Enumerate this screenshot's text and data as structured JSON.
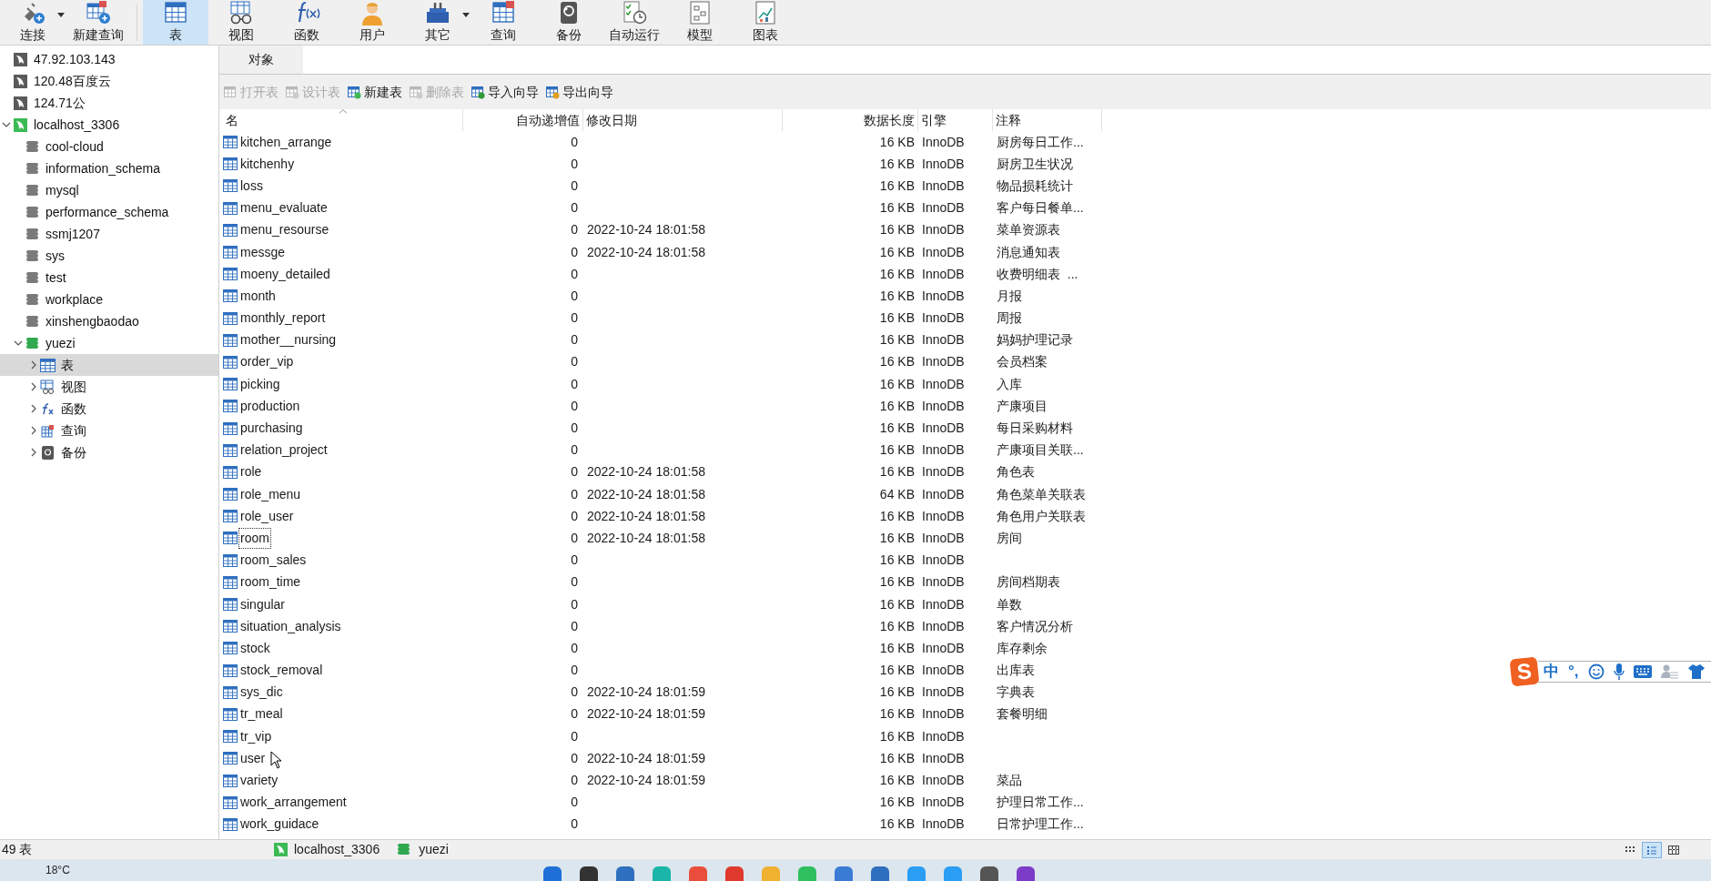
{
  "toolbar": [
    {
      "label": "连接",
      "kind": "connect",
      "selected": false,
      "has_menu": true
    },
    {
      "label": "新建查询",
      "kind": "new_query",
      "selected": false,
      "has_menu": false
    },
    {
      "label": "表",
      "kind": "table",
      "selected": true,
      "has_menu": false
    },
    {
      "label": "视图",
      "kind": "view",
      "selected": false,
      "has_menu": false
    },
    {
      "label": "函数",
      "kind": "function",
      "selected": false,
      "has_menu": false
    },
    {
      "label": "用户",
      "kind": "user",
      "selected": false,
      "has_menu": false
    },
    {
      "label": "其它",
      "kind": "other",
      "selected": false,
      "has_menu": true
    },
    {
      "label": "查询",
      "kind": "query",
      "selected": false,
      "has_menu": false
    },
    {
      "label": "备份",
      "kind": "backup",
      "selected": false,
      "has_menu": false
    },
    {
      "label": "自动运行",
      "kind": "schedule",
      "selected": false,
      "has_menu": false
    },
    {
      "label": "模型",
      "kind": "model",
      "selected": false,
      "has_menu": false
    },
    {
      "label": "图表",
      "kind": "chart",
      "selected": false,
      "has_menu": false
    }
  ],
  "tree": [
    {
      "label": "47.92.103.143",
      "kind": "connection",
      "open": false,
      "selected": false
    },
    {
      "label": "120.48百度云",
      "kind": "connection",
      "open": false,
      "selected": false
    },
    {
      "label": "124.71公",
      "kind": "connection",
      "open": false,
      "selected": false
    },
    {
      "label": "localhost_3306",
      "kind": "connection",
      "open": true,
      "selected": false,
      "expanded": true,
      "children": [
        {
          "label": "cool-cloud",
          "kind": "database",
          "open": false,
          "selected": false
        },
        {
          "label": "information_schema",
          "kind": "database",
          "open": false,
          "selected": false
        },
        {
          "label": "mysql",
          "kind": "database",
          "open": false,
          "selected": false
        },
        {
          "label": "performance_schema",
          "kind": "database",
          "open": false,
          "selected": false
        },
        {
          "label": "ssmj1207",
          "kind": "database",
          "open": false,
          "selected": false
        },
        {
          "label": "sys",
          "kind": "database",
          "open": false,
          "selected": false
        },
        {
          "label": "test",
          "kind": "database",
          "open": false,
          "selected": false
        },
        {
          "label": "workplace",
          "kind": "database",
          "open": false,
          "selected": false
        },
        {
          "label": "xinshengbaodao",
          "kind": "database",
          "open": false,
          "selected": false
        },
        {
          "label": "yuezi",
          "kind": "database",
          "open": true,
          "selected": false,
          "expanded": true,
          "children": [
            {
              "label": "表",
              "kind": "tables",
              "selected": true,
              "expanded": false
            },
            {
              "label": "视图",
              "kind": "views",
              "selected": false,
              "expanded": false
            },
            {
              "label": "函数",
              "kind": "functions",
              "selected": false,
              "expanded": false
            },
            {
              "label": "查询",
              "kind": "queries",
              "selected": false,
              "expanded": false
            },
            {
              "label": "备份",
              "kind": "backups",
              "selected": false,
              "expanded": false
            }
          ]
        }
      ]
    }
  ],
  "tabs": [
    {
      "label": "对象",
      "selected": true
    }
  ],
  "actions": [
    {
      "label": "打开表",
      "kind": "open",
      "disabled": true
    },
    {
      "label": "设计表",
      "kind": "design",
      "disabled": true
    },
    {
      "label": "新建表",
      "kind": "new",
      "disabled": false
    },
    {
      "label": "删除表",
      "kind": "delete",
      "disabled": true
    },
    {
      "label": "导入向导",
      "kind": "import",
      "disabled": false
    },
    {
      "label": "导出向导",
      "kind": "export",
      "disabled": false
    }
  ],
  "columns": [
    {
      "label": "名",
      "sorted": true
    },
    {
      "label": "自动递增值",
      "sorted": false
    },
    {
      "label": "修改日期",
      "sorted": false
    },
    {
      "label": "数据长度",
      "sorted": false
    },
    {
      "label": "引擎",
      "sorted": false
    },
    {
      "label": "注释",
      "sorted": false
    }
  ],
  "rows": [
    {
      "name": "kitchen_arrange",
      "auto_increment": "0",
      "size": "16 KB",
      "engine": "InnoDB",
      "comment": "厨房每日工作...",
      "focused": false
    },
    {
      "name": "kitchenhy",
      "auto_increment": "0",
      "size": "16 KB",
      "engine": "InnoDB",
      "comment": "厨房卫生状况",
      "focused": false
    },
    {
      "name": "loss",
      "auto_increment": "0",
      "size": "16 KB",
      "engine": "InnoDB",
      "comment": "物品损耗统计",
      "focused": false
    },
    {
      "name": "menu_evaluate",
      "auto_increment": "0",
      "size": "16 KB",
      "engine": "InnoDB",
      "comment": "客户每日餐单...",
      "focused": false
    },
    {
      "name": "menu_resourse",
      "auto_increment": "0",
      "modified": "2022-10-24 18:01:58",
      "size": "16 KB",
      "engine": "InnoDB",
      "comment": "菜单资源表",
      "focused": false
    },
    {
      "name": "messge",
      "auto_increment": "0",
      "modified": "2022-10-24 18:01:58",
      "size": "16 KB",
      "engine": "InnoDB",
      "comment": "消息通知表",
      "focused": false
    },
    {
      "name": "moeny_detailed",
      "auto_increment": "0",
      "size": "16 KB",
      "engine": "InnoDB",
      "comment": "收费明细表  ...",
      "focused": false
    },
    {
      "name": "month",
      "auto_increment": "0",
      "size": "16 KB",
      "engine": "InnoDB",
      "comment": "月报",
      "focused": false
    },
    {
      "name": "monthly_report",
      "auto_increment": "0",
      "size": "16 KB",
      "engine": "InnoDB",
      "comment": "周报",
      "focused": false
    },
    {
      "name": "mother__nursing",
      "auto_increment": "0",
      "size": "16 KB",
      "engine": "InnoDB",
      "comment": "妈妈护理记录",
      "focused": false
    },
    {
      "name": "order_vip",
      "auto_increment": "0",
      "size": "16 KB",
      "engine": "InnoDB",
      "comment": "会员档案",
      "focused": false
    },
    {
      "name": "picking",
      "auto_increment": "0",
      "size": "16 KB",
      "engine": "InnoDB",
      "comment": "入库",
      "focused": false
    },
    {
      "name": "production",
      "auto_increment": "0",
      "size": "16 KB",
      "engine": "InnoDB",
      "comment": "产康项目",
      "focused": false
    },
    {
      "name": "purchasing",
      "auto_increment": "0",
      "size": "16 KB",
      "engine": "InnoDB",
      "comment": "每日采购材料",
      "focused": false
    },
    {
      "name": "relation_project",
      "auto_increment": "0",
      "size": "16 KB",
      "engine": "InnoDB",
      "comment": "产康项目关联...",
      "focused": false
    },
    {
      "name": "role",
      "auto_increment": "0",
      "modified": "2022-10-24 18:01:58",
      "size": "16 KB",
      "engine": "InnoDB",
      "comment": "角色表",
      "focused": false
    },
    {
      "name": "role_menu",
      "auto_increment": "0",
      "modified": "2022-10-24 18:01:58",
      "size": "64 KB",
      "engine": "InnoDB",
      "comment": "角色菜单关联表",
      "focused": false
    },
    {
      "name": "role_user",
      "auto_increment": "0",
      "modified": "2022-10-24 18:01:58",
      "size": "16 KB",
      "engine": "InnoDB",
      "comment": "角色用户关联表",
      "focused": false
    },
    {
      "name": "room",
      "auto_increment": "0",
      "modified": "2022-10-24 18:01:58",
      "size": "16 KB",
      "engine": "InnoDB",
      "comment": "房间",
      "focused": true
    },
    {
      "name": "room_sales",
      "auto_increment": "0",
      "size": "16 KB",
      "engine": "InnoDB",
      "focused": false
    },
    {
      "name": "room_time",
      "auto_increment": "0",
      "size": "16 KB",
      "engine": "InnoDB",
      "comment": "房间档期表",
      "focused": false
    },
    {
      "name": "singular",
      "auto_increment": "0",
      "size": "16 KB",
      "engine": "InnoDB",
      "comment": "单数",
      "focused": false
    },
    {
      "name": "situation_analysis",
      "auto_increment": "0",
      "size": "16 KB",
      "engine": "InnoDB",
      "comment": "客户情况分析",
      "focused": false
    },
    {
      "name": "stock",
      "auto_increment": "0",
      "size": "16 KB",
      "engine": "InnoDB",
      "comment": "库存剩余",
      "focused": false
    },
    {
      "name": "stock_removal",
      "auto_increment": "0",
      "size": "16 KB",
      "engine": "InnoDB",
      "comment": "出库表",
      "focused": false
    },
    {
      "name": "sys_dic",
      "auto_increment": "0",
      "modified": "2022-10-24 18:01:59",
      "size": "16 KB",
      "engine": "InnoDB",
      "comment": "字典表",
      "focused": false
    },
    {
      "name": "tr_meal",
      "auto_increment": "0",
      "modified": "2022-10-24 18:01:59",
      "size": "16 KB",
      "engine": "InnoDB",
      "comment": "套餐明细",
      "focused": false
    },
    {
      "name": "tr_vip",
      "auto_increment": "0",
      "size": "16 KB",
      "engine": "InnoDB",
      "focused": false
    },
    {
      "name": "user",
      "auto_increment": "0",
      "modified": "2022-10-24 18:01:59",
      "size": "16 KB",
      "engine": "InnoDB",
      "focused": false
    },
    {
      "name": "variety",
      "auto_increment": "0",
      "modified": "2022-10-24 18:01:59",
      "size": "16 KB",
      "engine": "InnoDB",
      "comment": "菜品",
      "focused": false
    },
    {
      "name": "work_arrangement",
      "auto_increment": "0",
      "size": "16 KB",
      "engine": "InnoDB",
      "comment": "护理日常工作...",
      "focused": false
    },
    {
      "name": "work_guidace",
      "auto_increment": "0",
      "size": "16 KB",
      "engine": "InnoDB",
      "comment": "日常护理工作...",
      "focused": false
    }
  ],
  "status_bar": {
    "count": "49 表",
    "connection": "localhost_3306",
    "database": "yuezi",
    "view_modes": [
      {
        "kind": "grid",
        "selected": false
      },
      {
        "kind": "list",
        "selected": true
      },
      {
        "kind": "detail",
        "selected": false
      }
    ]
  },
  "ime": {
    "logo": "S",
    "mode": "中",
    "punct": "°,"
  },
  "taskbar": {
    "weather": "18°C"
  }
}
